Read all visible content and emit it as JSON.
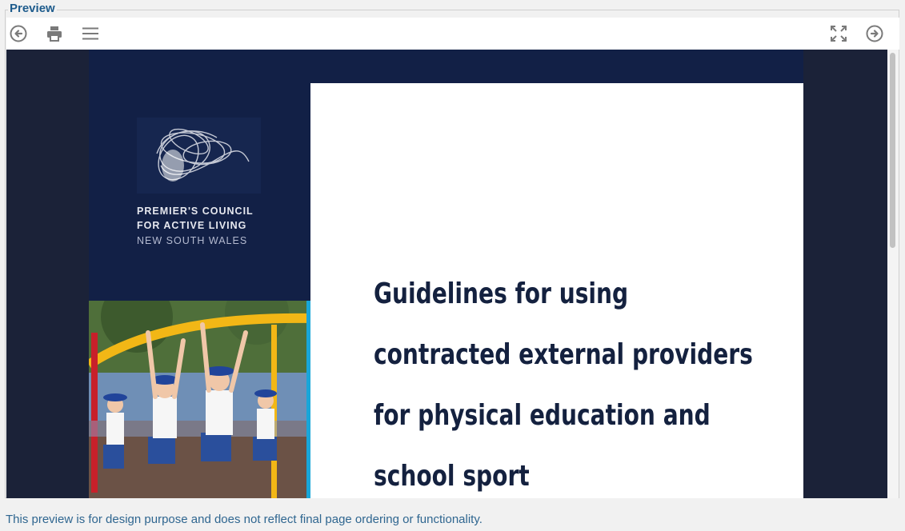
{
  "panel": {
    "legend": "Preview"
  },
  "toolbar": {
    "left_buttons": [
      "back-icon",
      "print-icon",
      "menu-icon"
    ],
    "right_buttons": [
      "fullscreen-icon",
      "forward-icon"
    ]
  },
  "document": {
    "logo_lines": [
      "PREMIER'S COUNCIL",
      "FOR ACTIVE LIVING",
      "NEW SOUTH WALES"
    ],
    "title_lines": [
      "Guidelines for using",
      "contracted external providers",
      "for physical education and",
      "school sport"
    ]
  },
  "footer": {
    "note": "This preview is for design purpose and does not reflect final page ordering or functionality."
  },
  "colors": {
    "page_navy": "#122046",
    "viewer_bg": "#1b2238",
    "title_text": "#14213f",
    "legend": "#1d5b8c",
    "accent_yellow": "#f2b716"
  }
}
